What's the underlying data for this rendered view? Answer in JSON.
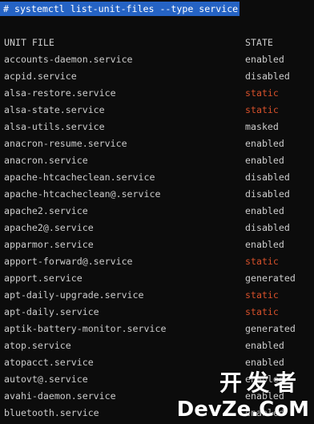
{
  "command": "# systemctl list-unit-files --type service",
  "header": {
    "unit": "UNIT FILE",
    "state": "STATE"
  },
  "rows": [
    {
      "unit": "accounts-daemon.service",
      "state": "enabled"
    },
    {
      "unit": "acpid.service",
      "state": "disabled"
    },
    {
      "unit": "alsa-restore.service",
      "state": "static"
    },
    {
      "unit": "alsa-state.service",
      "state": "static"
    },
    {
      "unit": "alsa-utils.service",
      "state": "masked"
    },
    {
      "unit": "anacron-resume.service",
      "state": "enabled"
    },
    {
      "unit": "anacron.service",
      "state": "enabled"
    },
    {
      "unit": "apache-htcacheclean.service",
      "state": "disabled"
    },
    {
      "unit": "apache-htcacheclean@.service",
      "state": "disabled"
    },
    {
      "unit": "apache2.service",
      "state": "enabled"
    },
    {
      "unit": "apache2@.service",
      "state": "disabled"
    },
    {
      "unit": "apparmor.service",
      "state": "enabled"
    },
    {
      "unit": "apport-forward@.service",
      "state": "static"
    },
    {
      "unit": "apport.service",
      "state": "generated"
    },
    {
      "unit": "apt-daily-upgrade.service",
      "state": "static"
    },
    {
      "unit": "apt-daily.service",
      "state": "static"
    },
    {
      "unit": "aptik-battery-monitor.service",
      "state": "generated"
    },
    {
      "unit": "atop.service",
      "state": "enabled"
    },
    {
      "unit": "atopacct.service",
      "state": "enabled"
    },
    {
      "unit": "autovt@.service",
      "state": "enabled"
    },
    {
      "unit": "avahi-daemon.service",
      "state": "enabled"
    },
    {
      "unit": "bluetooth.service",
      "state": "enabled"
    }
  ],
  "watermark": {
    "line1": "开发者",
    "line2": "DevZe.CoM"
  },
  "colors": {
    "background": "#0c0c0c",
    "text": "#cccccc",
    "selection": "#2563c4",
    "static_state": "#d6502a"
  }
}
